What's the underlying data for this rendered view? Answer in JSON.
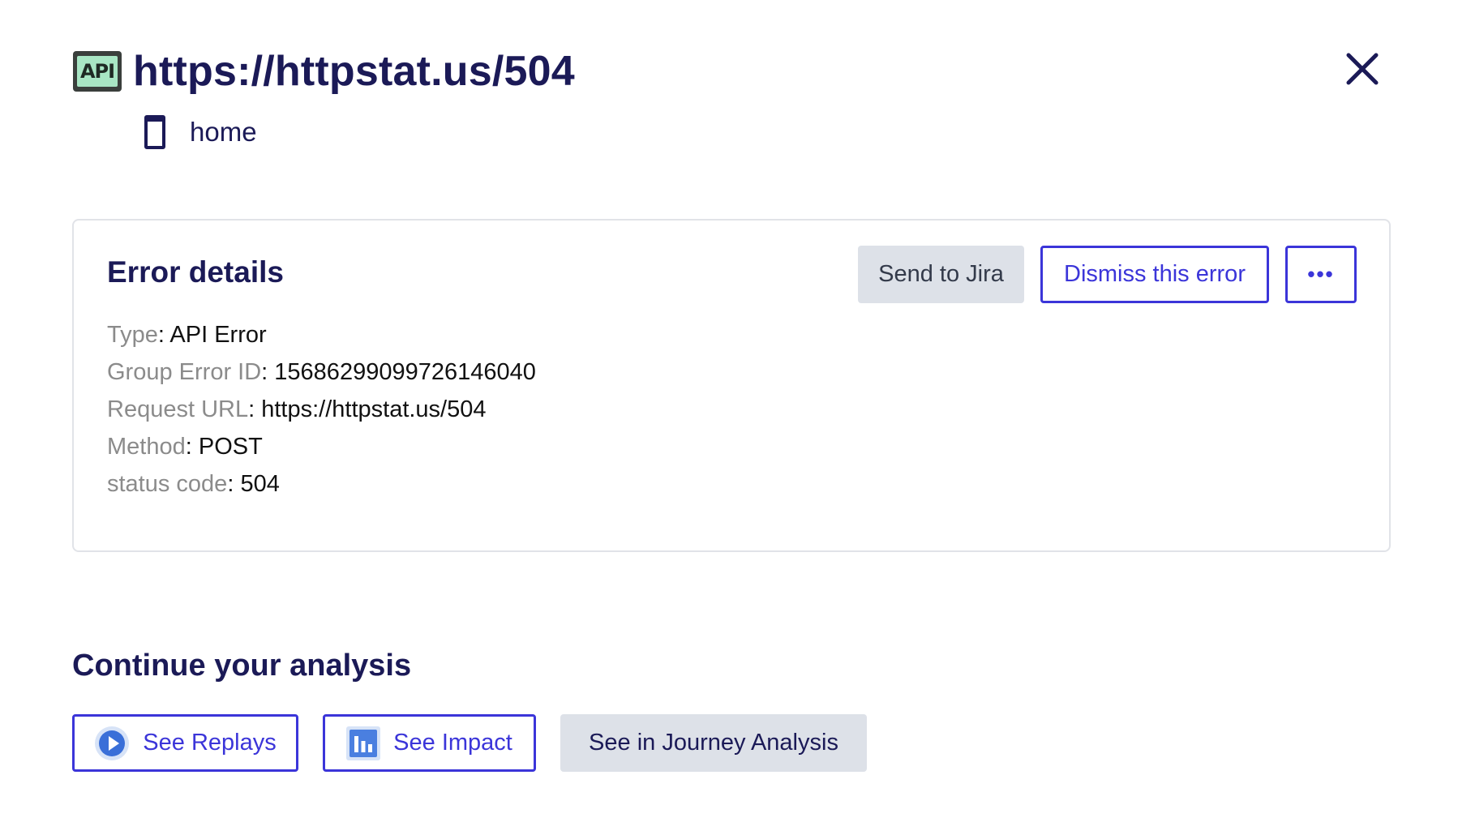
{
  "header": {
    "api_badge": "API",
    "title": "https://httpstat.us/504",
    "screen_name": "home"
  },
  "error_card": {
    "title": "Error details",
    "send_to_jira": "Send to Jira",
    "dismiss": "Dismiss this error",
    "more": "•••",
    "details": [
      {
        "key": "Type",
        "value": "API Error"
      },
      {
        "key": "Group Error ID",
        "value": "15686299099726146040"
      },
      {
        "key": "Request URL",
        "value": "https://httpstat.us/504"
      },
      {
        "key": "Method",
        "value": "POST"
      },
      {
        "key": "status code",
        "value": "504"
      }
    ]
  },
  "continue": {
    "title": "Continue your analysis",
    "see_replays": "See Replays",
    "see_impact": "See Impact",
    "see_journey": "See in Journey Analysis"
  },
  "icons": {
    "api": "api-badge-icon",
    "close": "close-icon",
    "device": "mobile-phone-icon",
    "play": "play-circle-icon",
    "chart": "bar-chart-icon"
  },
  "colors": {
    "primary": "#3b35d9",
    "navy": "#1b1a57",
    "button_gray": "#dde1e8",
    "api_badge_green": "#a8e6c4"
  }
}
